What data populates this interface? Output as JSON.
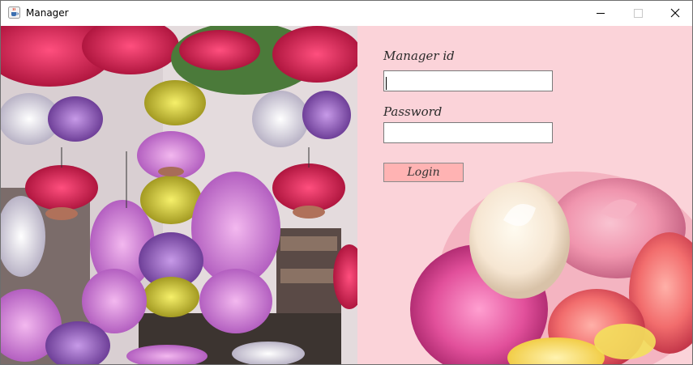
{
  "window": {
    "title": "Manager",
    "icon": "java-cup-icon",
    "controls": [
      "minimize-icon",
      "maximize-icon",
      "close-icon"
    ]
  },
  "login_form": {
    "id_label": "Manager id",
    "id_value": "",
    "password_label": "Password",
    "password_value": "",
    "login_button": "Login"
  },
  "colors": {
    "panel_background": "#fbd3d9",
    "login_button": "#ffb3b3"
  }
}
